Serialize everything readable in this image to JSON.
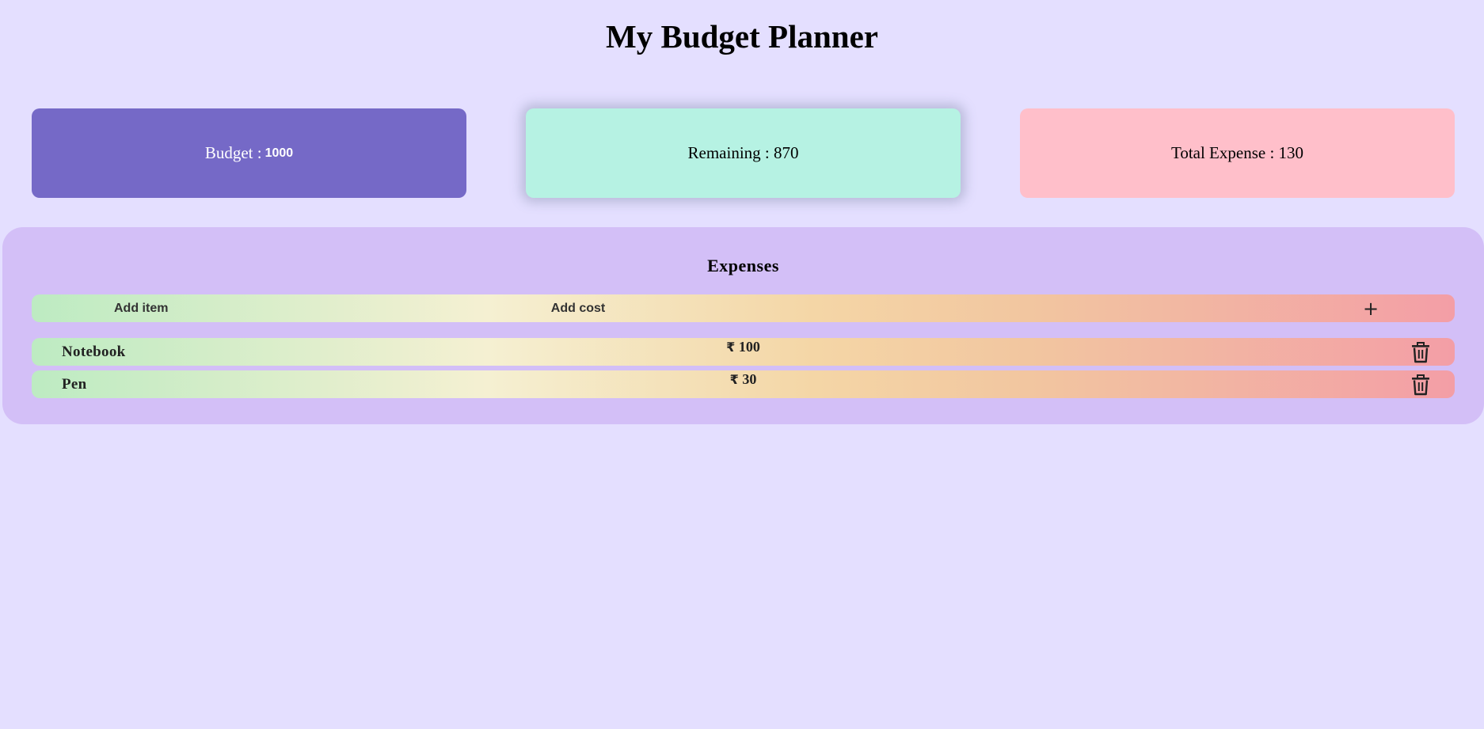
{
  "header": {
    "title": "My Budget Planner"
  },
  "cards": {
    "budget_label": "Budget :",
    "budget_value": "1000",
    "remaining_text": "Remaining : 870",
    "total_expense_text": "Total Expense : 130"
  },
  "expenses": {
    "heading": "Expenses",
    "add_item_placeholder": "Add item",
    "add_cost_placeholder": "Add cost",
    "add_button_label": "+",
    "currency_symbol": "₹",
    "items": [
      {
        "name": "Notebook",
        "cost": "100"
      },
      {
        "name": "Pen",
        "cost": "30"
      }
    ]
  },
  "icons": {
    "delete": "trash-icon",
    "add": "plus-icon"
  },
  "colors": {
    "page_background": "#e4dfff",
    "budget_card": "#7569c7",
    "remaining_card": "#b6f2e3",
    "expense_card": "#ffbfca",
    "expenses_panel": "#d3bff7",
    "row_gradient_start": "#bdebc2",
    "row_gradient_end": "#f39ea6"
  }
}
